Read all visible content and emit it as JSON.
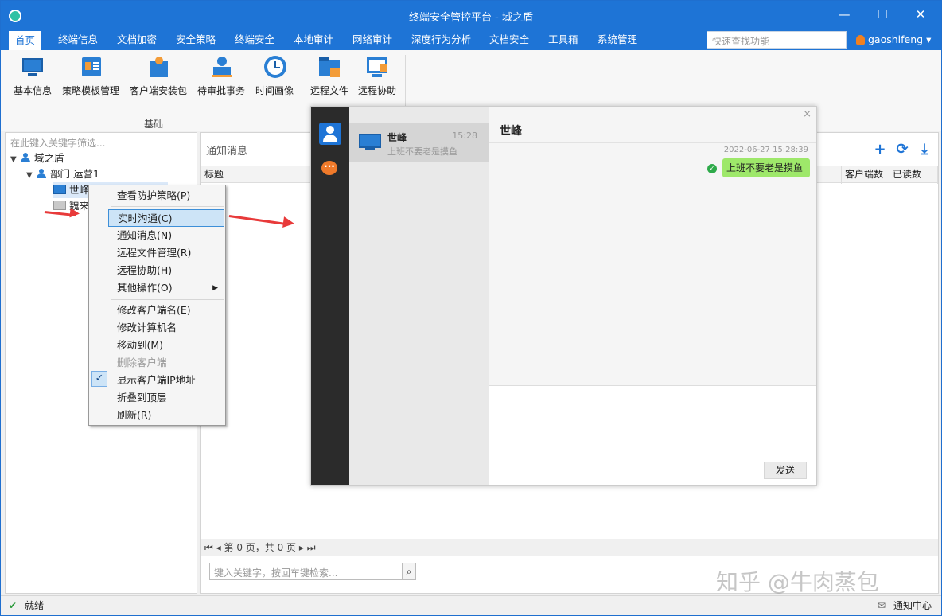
{
  "app": {
    "title": "终端安全管控平台 - 域之盾",
    "window_controls": {
      "minimize": "—",
      "maximize": "☐",
      "close": "✕"
    }
  },
  "menubar": {
    "items": [
      "首页",
      "终端信息",
      "文档加密",
      "安全策略",
      "终端安全",
      "本地审计",
      "网络审计",
      "深度行为分析",
      "文档安全",
      "工具箱",
      "系统管理"
    ],
    "quick_search_placeholder": "快速查找功能",
    "user": "gaoshifeng"
  },
  "ribbon": {
    "buttons": [
      {
        "label": "基本信息",
        "icon": "monitor-info-icon"
      },
      {
        "label": "策略模板管理",
        "icon": "policy-template-icon"
      },
      {
        "label": "客户端安装包",
        "icon": "install-package-icon"
      },
      {
        "label": "待审批事务",
        "icon": "approval-icon"
      },
      {
        "label": "时间画像",
        "icon": "clock-icon"
      },
      {
        "label": "远程文件",
        "icon": "remote-file-icon"
      },
      {
        "label": "远程协助",
        "icon": "remote-assist-icon"
      }
    ],
    "group_label": "基础"
  },
  "left": {
    "filter_placeholder": "在此键入关键字筛选...",
    "tree": {
      "root": "域之盾",
      "dept": "部门 运营1",
      "client1": "世峰",
      "client2": "魏来"
    }
  },
  "right": {
    "header": "通知消息",
    "columns": [
      "标题",
      "客户端数",
      "已读数"
    ],
    "pager": "第 0 页，共 0 页",
    "search_placeholder": "键入关键字，按回车键检索..."
  },
  "context_menu": {
    "items": [
      "查看防护策略(P)",
      "实时沟通(C)",
      "通知消息(N)",
      "远程文件管理(R)",
      "远程协助(H)",
      "其他操作(O)",
      "修改客户端名(E)",
      "修改计算机名",
      "移动到(M)",
      "删除客户端",
      "显示客户端IP地址",
      "折叠到顶层",
      "刷新(R)"
    ]
  },
  "chat": {
    "contact_name": "世峰",
    "contact_time": "15:28",
    "contact_preview": "上班不要老是摸鱼",
    "header_name": "世峰",
    "msg_timestamp": "2022-06-27 15:28:39",
    "msg_text": "上班不要老是摸鱼",
    "send_label": "发送",
    "close": "×"
  },
  "status": {
    "left": "就绪",
    "right": "通知中心"
  },
  "watermark": "知乎 @牛肉蒸包"
}
